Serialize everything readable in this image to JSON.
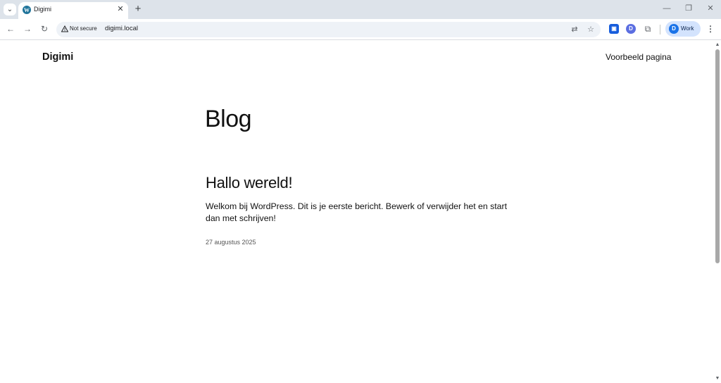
{
  "browser": {
    "tab": {
      "title": "Digimi",
      "favicon": "wordpress-icon",
      "close_glyph": "✕"
    },
    "tab_search_glyph": "⌄",
    "new_tab_glyph": "+",
    "window_controls": {
      "minimize": "—",
      "restore": "❐",
      "close": "✕"
    },
    "nav": {
      "back": "←",
      "forward": "→",
      "reload": "↻"
    },
    "omnibox": {
      "security_label": "Not secure",
      "url": "digimi.local",
      "translate_glyph": "⇄",
      "bookmark_glyph": "☆"
    },
    "extensions": [
      {
        "name": "bitwarden-icon",
        "glyph": "▣",
        "color": "#175ddc"
      },
      {
        "name": "extension-d-icon",
        "glyph": "D",
        "color": "#5b6ee1"
      }
    ],
    "puzzle_glyph": "⧉",
    "profile": {
      "label": "Work",
      "avatar_glyph": "D"
    },
    "menu_glyph": "⋮"
  },
  "site": {
    "title": "Digimi",
    "nav_link": "Voorbeeld pagina"
  },
  "main": {
    "heading": "Blog",
    "posts": [
      {
        "title": "Hallo wereld!",
        "excerpt": "Welkom bij WordPress. Dit is je eerste bericht. Bewerk of verwijder het en start dan met schrijven!",
        "date": "27 augustus 2025"
      }
    ]
  },
  "scrollbar": {
    "up_glyph": "▲",
    "down_glyph": "▼"
  }
}
